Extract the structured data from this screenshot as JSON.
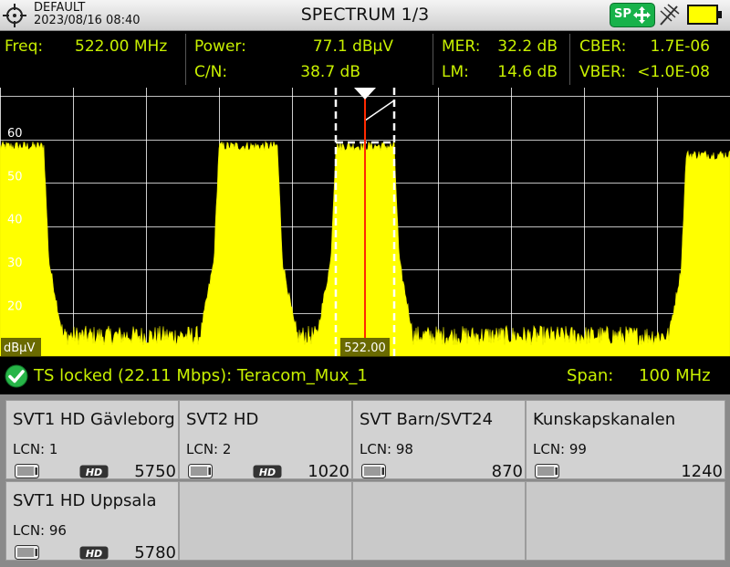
{
  "header": {
    "profile_name": "DEFAULT",
    "date": "2023/08/16 08:40",
    "title": "SPECTRUM 1/3",
    "sp_badge": "SP",
    "icons": [
      "crosshair-icon",
      "move-arrows-icon",
      "antenna-icon",
      "battery-icon"
    ]
  },
  "measurements": {
    "freq_label": "Freq:",
    "freq_value": "522.00 MHz",
    "power_label": "Power:",
    "power_value": "77.1 dBµV",
    "cn_label": "C/N:",
    "cn_value": "38.7 dB",
    "mer_label": "MER:",
    "mer_value": "32.2 dB",
    "lm_label": "LM:",
    "lm_value": "14.6 dB",
    "cber_label": "CBER:",
    "cber_value": "1.7E-06",
    "vber_label": "VBER:",
    "vber_value": "<1.0E-08"
  },
  "spectrum": {
    "y_ticks": [
      "60",
      "50",
      "40",
      "30",
      "20"
    ],
    "y_unit": "dBµV",
    "marker_freq_label": "522.00"
  },
  "chart_data": {
    "type": "area",
    "center_mhz": 522,
    "span_mhz": 100,
    "ylim": [
      10,
      72
    ],
    "noise_floor_dbuv": 15,
    "marker_mhz": 522,
    "channels": [
      {
        "center_mhz": 474,
        "width_mhz": 8,
        "level_dbuv": 59
      },
      {
        "center_mhz": 506,
        "width_mhz": 8,
        "level_dbuv": 59
      },
      {
        "center_mhz": 522,
        "width_mhz": 8,
        "level_dbuv": 59
      },
      {
        "center_mhz": 570,
        "width_mhz": 8,
        "level_dbuv": 57
      }
    ],
    "colors": {
      "trace": "#ffff00",
      "grid": "#ffffff",
      "marker": "#ff2a00"
    }
  },
  "status": {
    "ts_text": "TS locked (22.11 Mbps): Teracom_Mux_1",
    "span_label": "Span:",
    "span_value": "100 MHz"
  },
  "services": [
    {
      "name": "SVT1 HD Gävleborg",
      "lcn": "LCN: 1",
      "hd": "HD",
      "pid": "5750"
    },
    {
      "name": "SVT2 HD",
      "lcn": "LCN: 2",
      "hd": "HD",
      "pid": "1020"
    },
    {
      "name": "SVT Barn/SVT24",
      "lcn": "LCN: 98",
      "hd": "",
      "pid": "870"
    },
    {
      "name": "Kunskapskanalen",
      "lcn": "LCN: 99",
      "hd": "",
      "pid": "1240"
    },
    {
      "name": "SVT1 HD Uppsala",
      "lcn": "LCN: 96",
      "hd": "HD",
      "pid": "5780"
    }
  ]
}
